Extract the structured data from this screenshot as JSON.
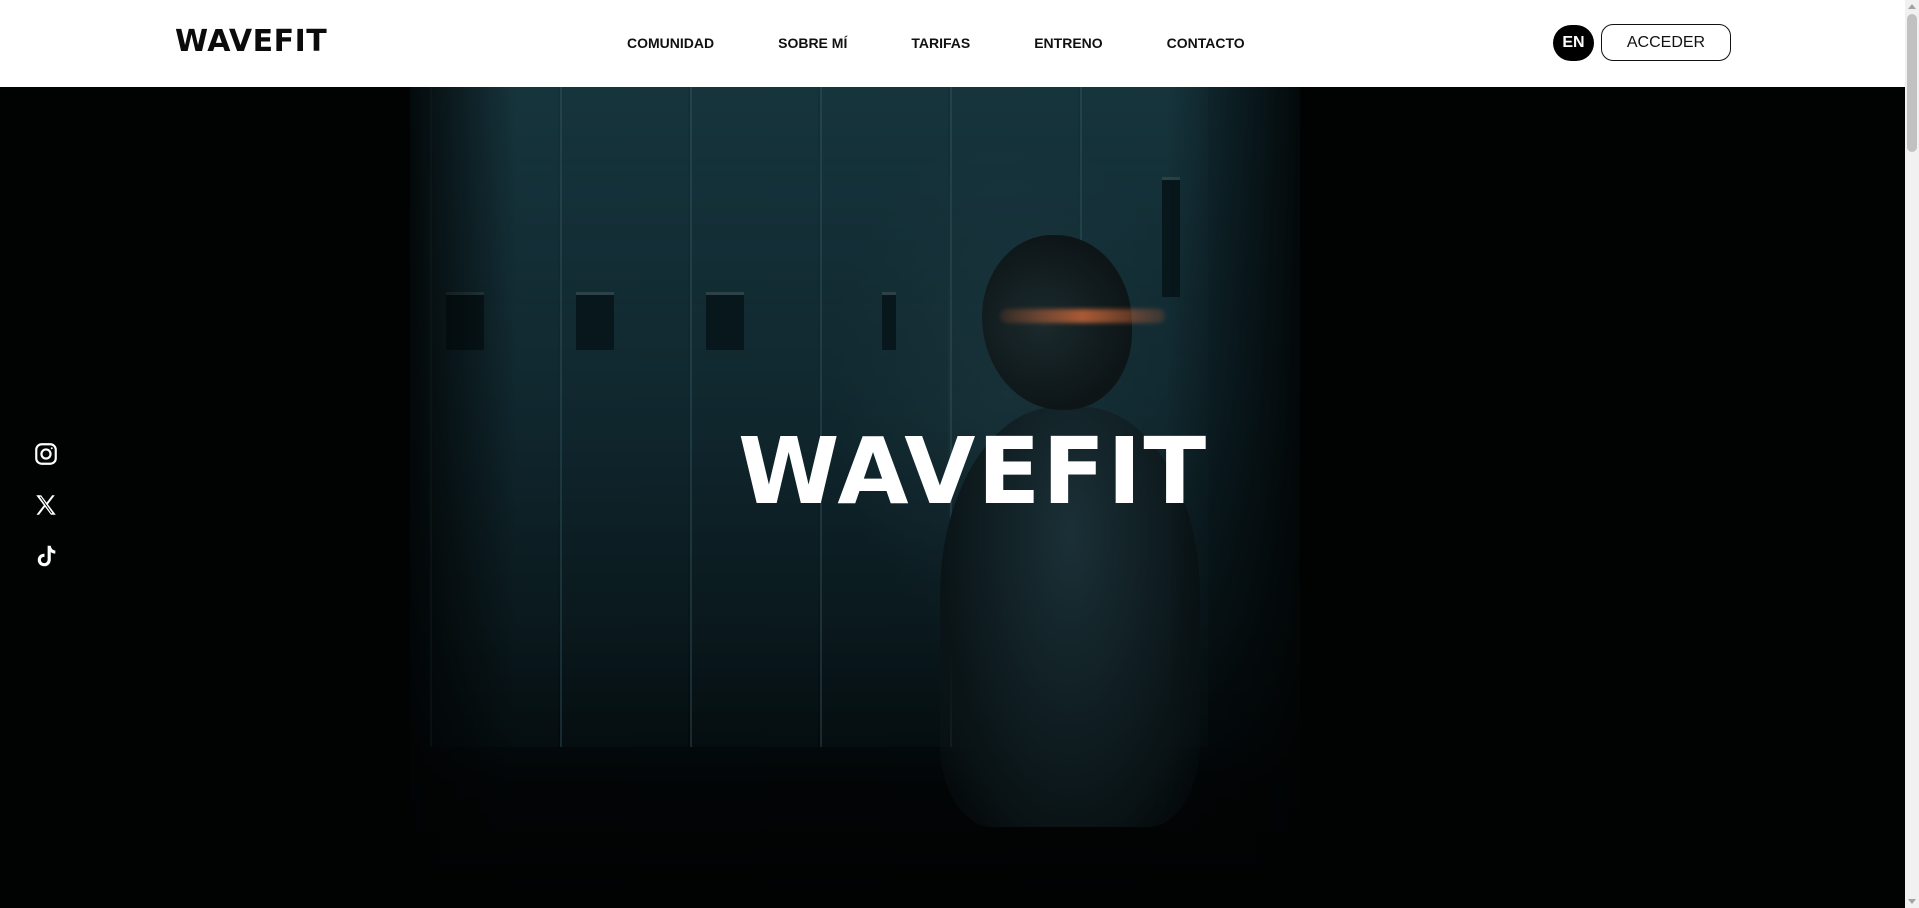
{
  "header": {
    "brand": "WAVEFIT",
    "nav": [
      {
        "label": "COMUNIDAD"
      },
      {
        "label": "SOBRE MÍ"
      },
      {
        "label": "TARIFAS"
      },
      {
        "label": "ENTRENO"
      },
      {
        "label": "CONTACTO"
      }
    ],
    "language_label": "EN",
    "access_label": "ACCEDER"
  },
  "hero": {
    "title": "WAVEFIT",
    "background_icon": "locker-room-photo"
  },
  "social": [
    {
      "icon": "instagram-icon"
    },
    {
      "icon": "x-icon"
    },
    {
      "icon": "tiktok-icon"
    }
  ],
  "colors": {
    "header_bg": "#ffffff",
    "text_dark": "#111111",
    "hero_bg": "#010303",
    "hero_text": "#ffffff",
    "accent_glow": "#dc6e3c"
  }
}
